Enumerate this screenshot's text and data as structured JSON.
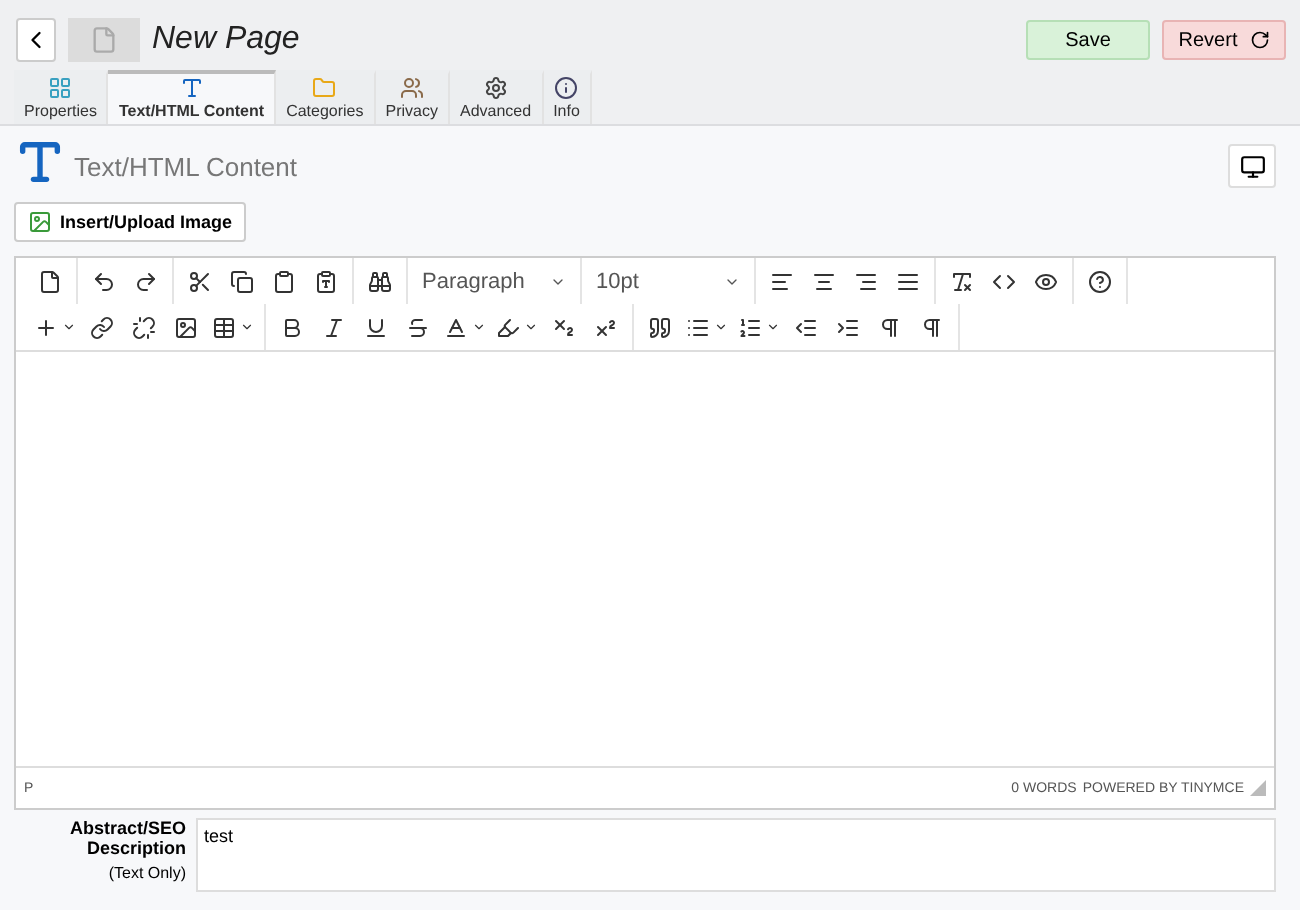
{
  "header": {
    "title": "New Page",
    "save": "Save",
    "revert": "Revert"
  },
  "tabs": [
    {
      "label": "Properties",
      "kind": "grid",
      "selected": false
    },
    {
      "label": "Text/HTML Content",
      "kind": "text",
      "selected": true
    },
    {
      "label": "Categories",
      "kind": "folder",
      "selected": false
    },
    {
      "label": "Privacy",
      "kind": "users",
      "selected": false
    },
    {
      "label": "Advanced",
      "kind": "gear",
      "selected": false
    },
    {
      "label": "Info",
      "kind": "info",
      "selected": false
    }
  ],
  "section": {
    "title": "Text/HTML Content",
    "insert_button": "Insert/Upload Image"
  },
  "editor": {
    "block_format": "Paragraph",
    "font_size": "10pt",
    "path": "P",
    "word_count": "0 WORDS",
    "powered_by": "POWERED BY TINYMCE"
  },
  "abstract": {
    "label": "Abstract/SEO Description",
    "note": "(Text Only)",
    "value": "test"
  }
}
